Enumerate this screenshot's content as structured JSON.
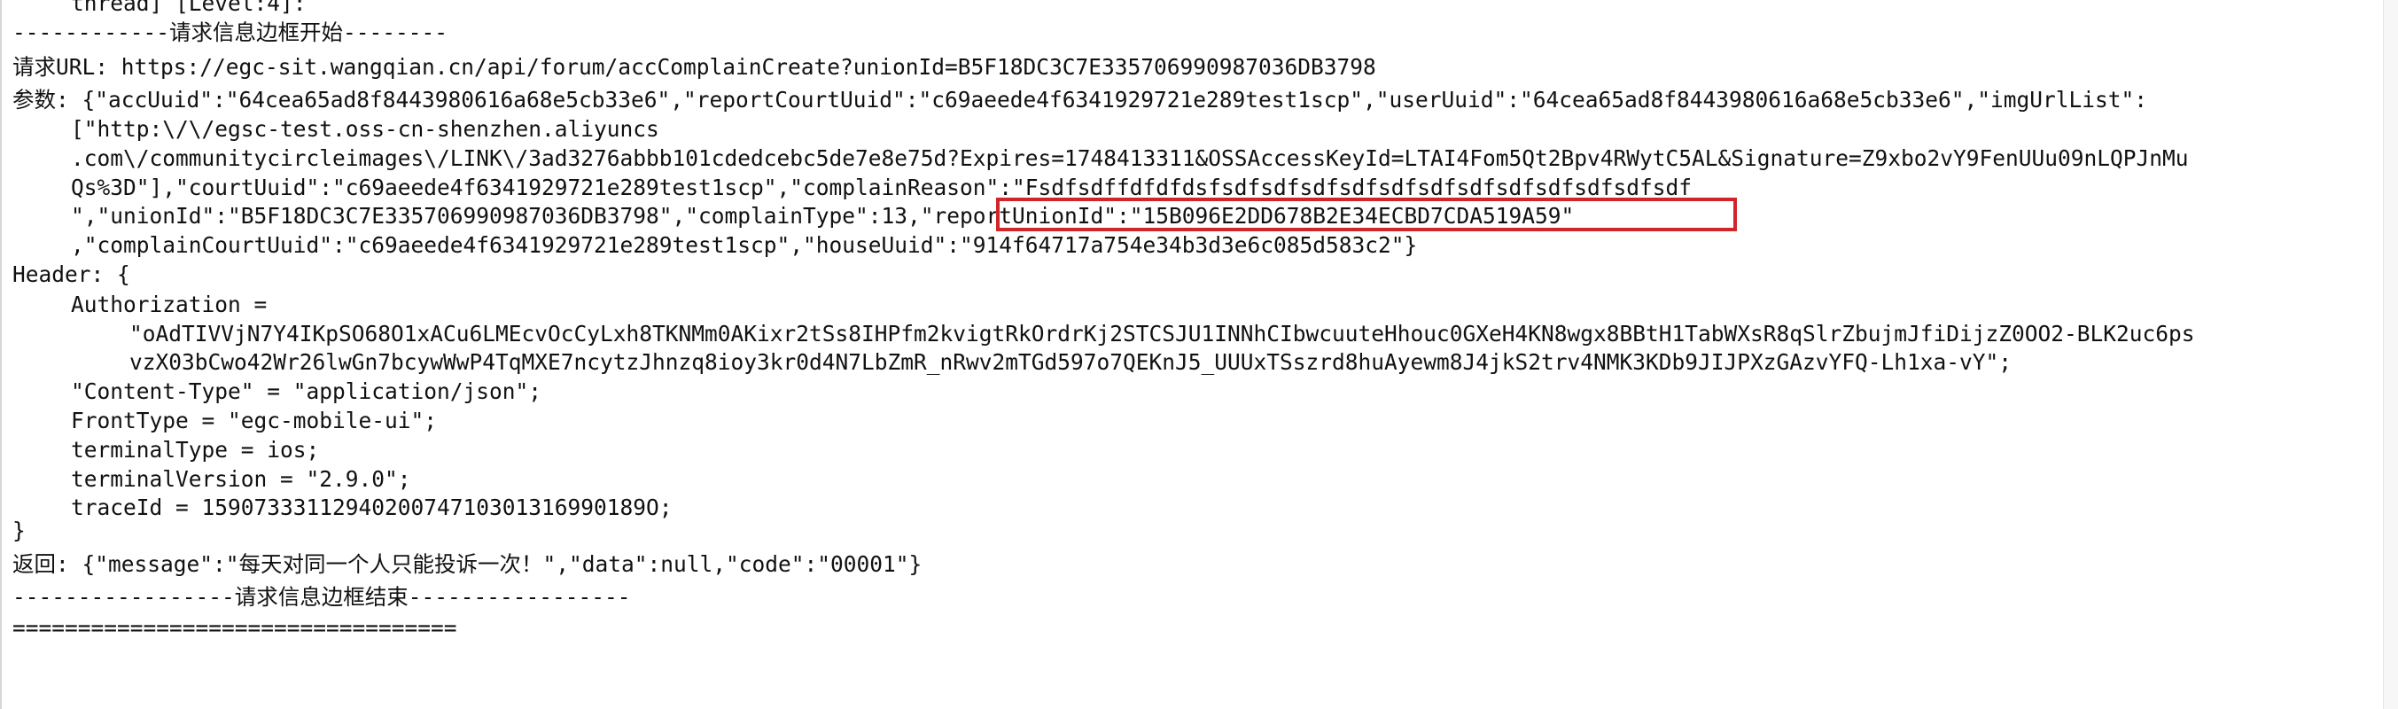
{
  "console": {
    "lines": [
      {
        "indent": 1,
        "text": "thread] [Level:4]:"
      },
      {
        "indent": 0,
        "text": "------------请求信息边框开始--------"
      },
      {
        "indent": 0,
        "text": "请求URL: https://egc-sit.wangqian.cn/api/forum/accComplainCreate?unionId=B5F18DC3C7E335706990987036DB3798"
      },
      {
        "indent": 0,
        "text": "参数: {\"accUuid\":\"64cea65ad8f8443980616a68e5cb33e6\",\"reportCourtUuid\":\"c69aeede4f6341929721e289test1scp\",\"userUuid\":\"64cea65ad8f8443980616a68e5cb33e6\",\"imgUrlList\":"
      },
      {
        "indent": 1,
        "text": "[\"http:\\/\\/egsc-test.oss-cn-shenzhen.aliyuncs"
      },
      {
        "indent": 1,
        "text": ".com\\/communitycircleimages\\/LINK\\/3ad3276abbb101cdedcebc5de7e8e75d?Expires=1748413311&OSSAccessKeyId=LTAI4Fom5Qt2Bpv4RWytC5AL&Signature=Z9xbo2vY9FenUUu09nLQPJnMu"
      },
      {
        "indent": 1,
        "text": "Qs%3D\"],\"courtUuid\":\"c69aeede4f6341929721e289test1scp\",\"complainReason\":\"Fsdfsdffdfdfdsfsdfsdfsdfsdfsdfsdfsdfsdfsdfsdfsdfsdf"
      },
      {
        "indent": 1,
        "text": "\",\"unionId\":\"B5F18DC3C7E335706990987036DB3798\",\"complainType\":13,\"reportUnionId\":\"15B096E2DD678B2E34ECBD7CDA519A59\""
      },
      {
        "indent": 1,
        "text": ",\"complainCourtUuid\":\"c69aeede4f6341929721e289test1scp\",\"houseUuid\":\"914f64717a754e34b3d3e6c085d583c2\"}"
      },
      {
        "indent": 0,
        "text": "Header: {"
      },
      {
        "indent": 1,
        "text": "Authorization ="
      },
      {
        "indent": 2,
        "text": "\"oAdTIVVjN7Y4IKpSO68O1xACu6LMEcvOcCyLxh8TKNMm0AKixr2tSs8IHPfm2kvigtRkOrdrKj2STCSJU1INNhCIbwcuuteHhouc0GXeH4KN8wgx8BBtH1TabWXsR8qSlrZbujmJfiDijzZ0OO2-BLK2uc6ps"
      },
      {
        "indent": 2,
        "text": "vzX03bCwo42Wr26lwGn7bcywWwP4TqMXE7ncytzJhnzq8ioy3kr0d4N7LbZmR_nRwv2mTGd597o7QEKnJ5_UUUxTSszrd8huAyewm8J4jkS2trv4NMK3KDb9JIJPXzGAzvYFQ-Lh1xa-vY\";"
      },
      {
        "indent": 1,
        "text": "\"Content-Type\" = \"application/json\";"
      },
      {
        "indent": 1,
        "text": "FrontType = \"egc-mobile-ui\";"
      },
      {
        "indent": 1,
        "text": "terminalType = ios;"
      },
      {
        "indent": 1,
        "text": "terminalVersion = \"2.9.0\";"
      },
      {
        "indent": 1,
        "text": "traceId = 1590733311294020074710301316990189O;"
      },
      {
        "indent": 0,
        "text": "}"
      },
      {
        "indent": 0,
        "text": "返回: {\"message\":\"每天对同一个人只能投诉一次！\",\"data\":null,\"code\":\"00001\"}"
      },
      {
        "indent": 0,
        "text": "-----------------请求信息边框结束-----------------"
      },
      {
        "indent": 0,
        "text": "=================================="
      }
    ]
  },
  "annotation": {
    "highlight_color": "#d0262b",
    "highlighted_text": "\"reportUnionId\":\"15B096E2DD678B2E34ECBD7CDA519A59\""
  }
}
